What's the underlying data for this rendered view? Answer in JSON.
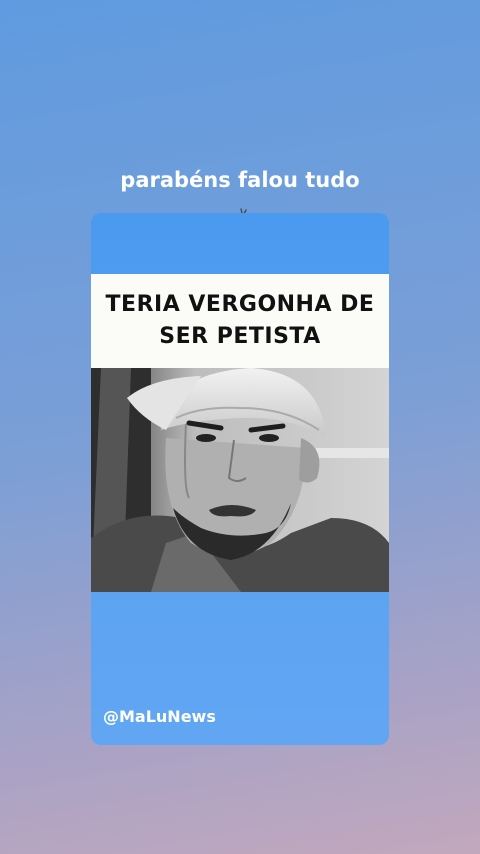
{
  "story": {
    "caption": "parabéns falou tudo",
    "emoji_icon": "clapping-hands-icon"
  },
  "post": {
    "headline": "TERIA VERGONHA DE SER PETISTA",
    "photo_icon": "man-in-cap-photo",
    "handle": "@MaLuNews",
    "card_color": "#4a9af0"
  }
}
